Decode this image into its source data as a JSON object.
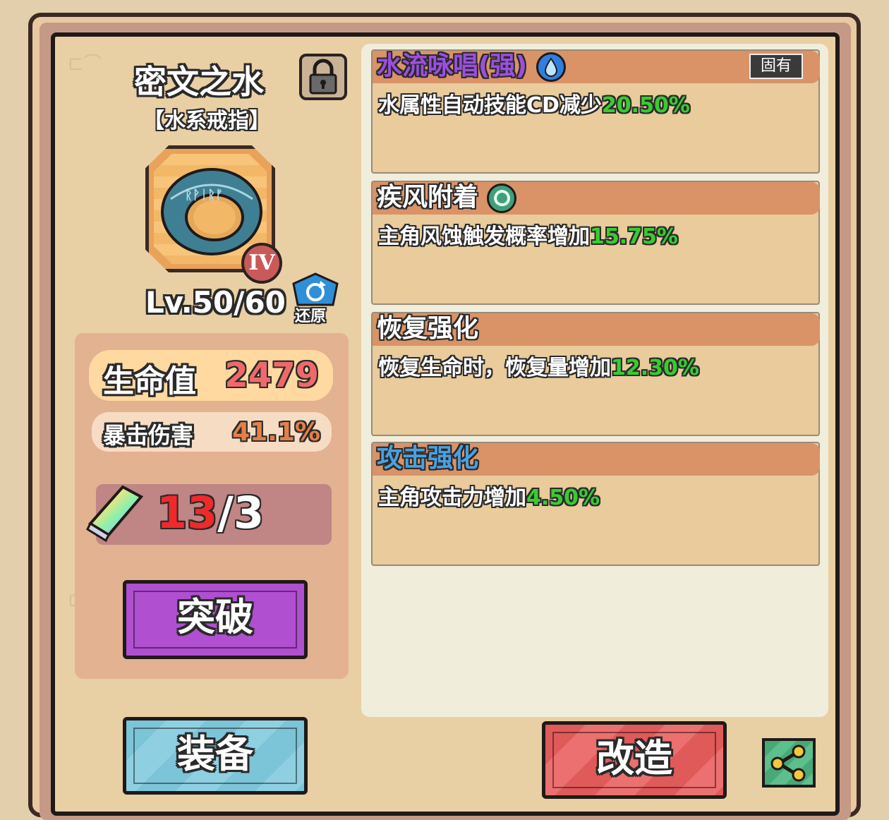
{
  "item": {
    "name": "密文之水",
    "type": "【水系戒指】",
    "rank": "IV",
    "level": "Lv.50/60",
    "restore_label": "还原"
  },
  "stats": {
    "hp_label": "生命值",
    "hp_value": "2479",
    "crit_label": "暴击伤害",
    "crit_value": "41.1%"
  },
  "stones": {
    "current": "13",
    "separator": "/",
    "max": "3"
  },
  "buttons": {
    "break": "突破",
    "equip": "装备",
    "modify": "改造"
  },
  "skills": [
    {
      "name": "水流咏唱(强)",
      "name_color": "#9b4fe0",
      "tag": "固有",
      "desc": "水属性自动技能CD减少",
      "pct": "20.50%",
      "icon": "water-drop-icon"
    },
    {
      "name": "疾风附着",
      "name_color": "#ffffff",
      "desc": "主角风蚀触发概率增加",
      "pct": "15.75%",
      "icon": "wind-swirl-icon"
    },
    {
      "name": "恢复强化",
      "name_color": "#ffffff",
      "desc": "恢复生命时，恢复量增加",
      "pct": "12.30%"
    },
    {
      "name": "攻击强化",
      "name_color": "#4aa0e0",
      "desc": "主角攻击力增加",
      "pct": "4.50%"
    }
  ],
  "colors": {
    "hp_value": "#ee6a6a",
    "crit_value": "#e2804a",
    "pct_green": "#38cc30",
    "break_button": "#b04fd0",
    "equip_button": "#7cc4d8",
    "modify_button": "#e05a5a"
  }
}
